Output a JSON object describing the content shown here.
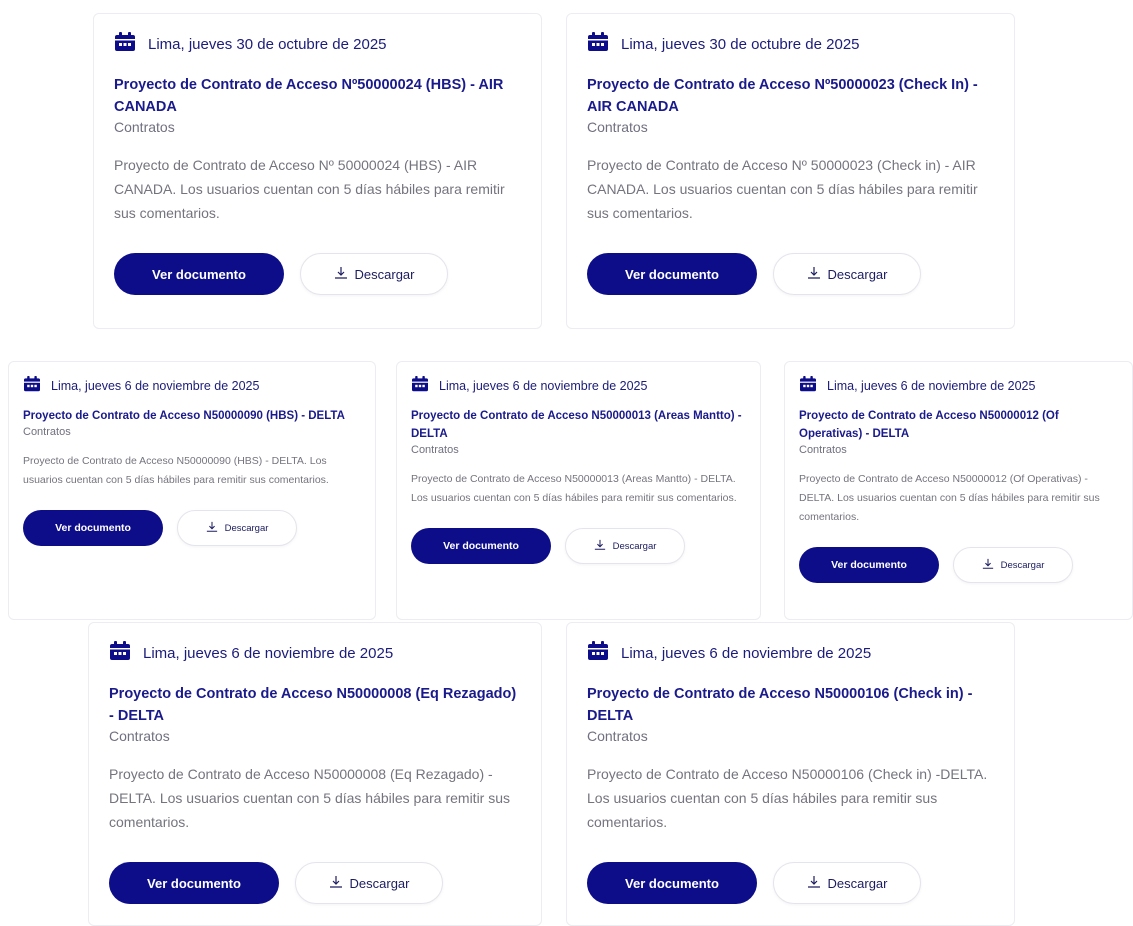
{
  "cards": [
    {
      "date": "Lima, jueves 30 de octubre de 2025",
      "title": "Proyecto de Contrato de Acceso Nº50000024 (HBS) - AIR CANADA",
      "category": "Contratos",
      "description": "Proyecto de Contrato de Acceso Nº 50000024 (HBS) - AIR CANADA. Los usuarios cuentan con 5 días hábiles para remitir sus comentarios.",
      "view_label": "Ver documento",
      "download_label": "Descargar"
    },
    {
      "date": "Lima, jueves 30 de octubre de 2025",
      "title": "Proyecto de Contrato de Acceso Nº50000023 (Check In) - AIR CANADA",
      "category": "Contratos",
      "description": "Proyecto de Contrato de Acceso Nº 50000023 (Check in) - AIR CANADA. Los usuarios cuentan con 5 días hábiles para remitir sus comentarios.",
      "view_label": "Ver documento",
      "download_label": "Descargar"
    },
    {
      "date": "Lima, jueves 6 de noviembre de 2025",
      "title": "Proyecto de Contrato de Acceso N50000090 (HBS) - DELTA",
      "category": "Contratos",
      "description": "Proyecto de Contrato de Acceso N50000090 (HBS) - DELTA. Los usuarios cuentan con 5 días hábiles para remitir sus comentarios.",
      "view_label": "Ver documento",
      "download_label": "Descargar"
    },
    {
      "date": "Lima, jueves 6 de noviembre de 2025",
      "title": "Proyecto de Contrato de Acceso N50000013 (Areas Mantto) - DELTA",
      "category": "Contratos",
      "description": "Proyecto de Contrato de Acceso N50000013 (Areas Mantto) - DELTA. Los usuarios cuentan con 5 días hábiles para remitir sus comentarios.",
      "view_label": "Ver documento",
      "download_label": "Descargar"
    },
    {
      "date": "Lima, jueves 6 de noviembre de 2025",
      "title": "Proyecto de Contrato de Acceso N50000012 (Of Operativas) - DELTA",
      "category": "Contratos",
      "description": "Proyecto de Contrato de Acceso N50000012 (Of Operativas) - DELTA. Los usuarios cuentan con 5 días hábiles para remitir sus comentarios.",
      "view_label": "Ver documento",
      "download_label": "Descargar"
    },
    {
      "date": "Lima, jueves 6 de noviembre de 2025",
      "title": "Proyecto de Contrato de Acceso N50000008 (Eq Rezagado) - DELTA",
      "category": "Contratos",
      "description": "Proyecto de Contrato de Acceso N50000008 (Eq Rezagado) - DELTA. Los usuarios cuentan con 5 días hábiles para remitir sus comentarios.",
      "view_label": "Ver documento",
      "download_label": "Descargar"
    },
    {
      "date": "Lima, jueves 6 de noviembre de 2025",
      "title": "Proyecto de Contrato de Acceso N50000106 (Check in) -DELTA",
      "category": "Contratos",
      "description": "Proyecto de Contrato de Acceso N50000106 (Check in) -DELTA. Los usuarios cuentan con 5 días hábiles para remitir sus comentarios.",
      "view_label": "Ver documento",
      "download_label": "Descargar"
    }
  ],
  "icons": {
    "date": "calendar-icon",
    "download": "download-icon"
  },
  "colors": {
    "primary": "#0d0d8a",
    "title": "#1a1a8c"
  }
}
